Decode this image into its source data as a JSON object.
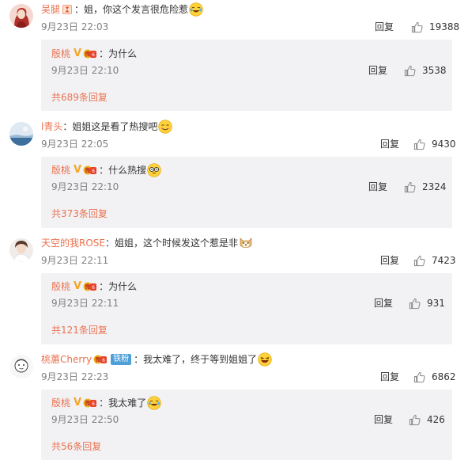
{
  "actions": {
    "reply_label": "回复"
  },
  "colors": {
    "username": "#eb7350",
    "meta": "#808080",
    "subbg": "#f2f2f5"
  },
  "comments": [
    {
      "username": "吴腿",
      "text": "：姐，你这个发言很危险惹",
      "time": "9月23日 22:03",
      "likes": "19388",
      "emoji": "laughing-tears",
      "reply": {
        "username": "殷桃",
        "text": "：为什么",
        "time": "9月23日 22:10",
        "likes": "3538",
        "more": "共689条回复"
      }
    },
    {
      "username": "l青头",
      "text": "：姐姐这是看了热搜吧",
      "time": "9月23日 22:05",
      "likes": "9430",
      "emoji": "smile",
      "reply": {
        "username": "殷桃",
        "text": "：什么热搜",
        "time": "9月23日 22:10",
        "likes": "2324",
        "more": "共373条回复"
      }
    },
    {
      "username": "天空的我ROSE",
      "text": "：姐姐，这个时候发这个惹是非",
      "time": "9月23日 22:11",
      "likes": "7423",
      "emoji": "doge",
      "reply": {
        "username": "殷桃",
        "text": "：为什么",
        "time": "9月23日 22:11",
        "likes": "931",
        "more": "共121条回复"
      }
    },
    {
      "username": "桃蕙Cherry",
      "fan_badge": "铁粉",
      "text": "：我太难了，终于等到姐姐了",
      "time": "9月23日 22:23",
      "likes": "6862",
      "emoji": "haha",
      "reply": {
        "username": "殷桃",
        "text": "：我太难了",
        "time": "9月23日 22:50",
        "likes": "426",
        "more": "共56条回复"
      }
    }
  ]
}
